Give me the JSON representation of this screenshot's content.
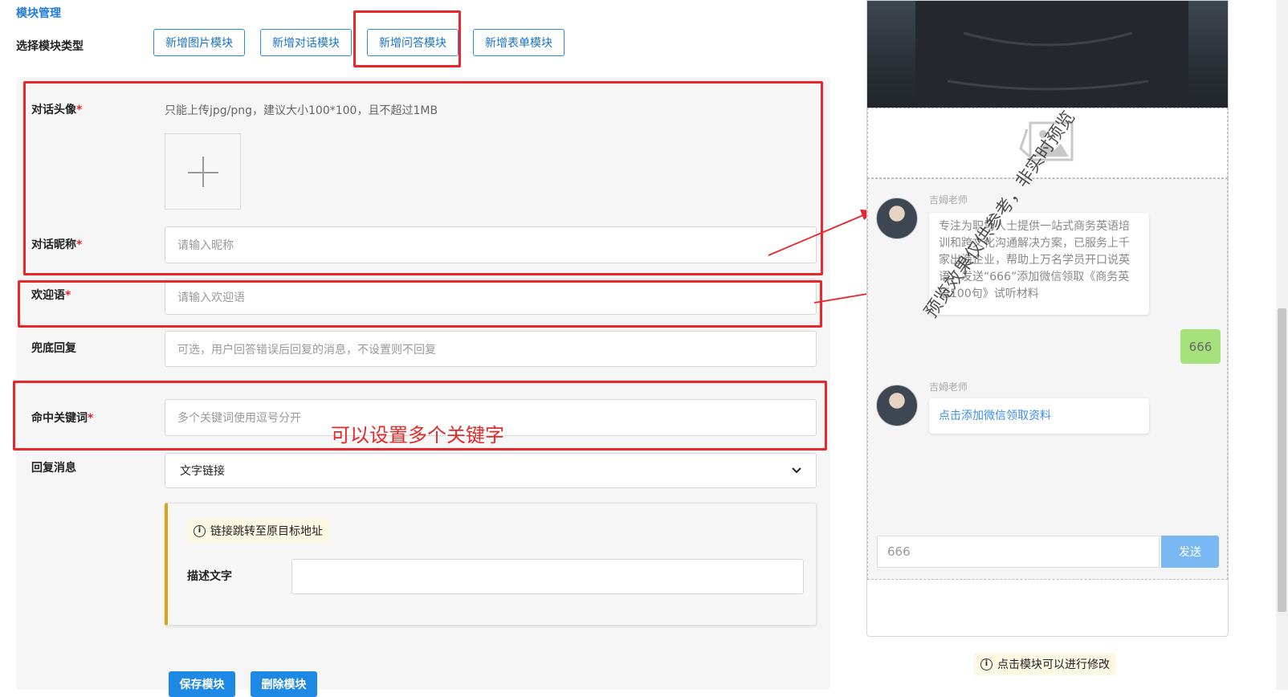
{
  "header": {
    "section_title": "模块管理",
    "type_label": "选择模块类型",
    "type_buttons": [
      "新增图片模块",
      "新增对话模块",
      "新增问答模块",
      "新增表单模块"
    ]
  },
  "form": {
    "avatar_label": "对话头像",
    "avatar_hint": "只能上传jpg/png，建议大小100*100，且不超过1MB",
    "nickname_label": "对话昵称",
    "nickname_placeholder": "请输入昵称",
    "welcome_label": "欢迎语",
    "welcome_placeholder": "请输入欢迎语",
    "fallback_label": "兜底回复",
    "fallback_placeholder": "可选，用户回答错误后回复的消息，不设置则不回复",
    "keyword_label": "命中关键词",
    "keyword_placeholder": "多个关键词使用逗号分开",
    "reply_label": "回复消息",
    "reply_selected": "文字链接",
    "link_notice": "链接跳转至原目标地址",
    "desc_label": "描述文字",
    "desc_value": "",
    "required_mark": "*",
    "save_button": "保存模块",
    "delete_button": "删除模块"
  },
  "annotation": {
    "keyword_note": "可以设置多个关键字"
  },
  "preview": {
    "sender_name": "吉姆老师",
    "welcome_message": "专注为职场人士提供一站式商务英语培训和跨文化沟通解决方案，已服务上千家出海企业，帮助上万名学员开口说英语，发送“666”添加微信领取《商务英语100句》试听材料",
    "user_reply": "666",
    "reply_sender_name": "吉姆老师",
    "reply_link": "点击添加微信领取资料",
    "input_value": "666",
    "send_button": "发送",
    "watermark": "预览效果仅供参考，非实时预览",
    "bottom_tip": "点击模块可以进行修改"
  },
  "colors": {
    "accent_blue": "#1e88e5",
    "annotation_red": "#e8262c",
    "reply_green": "#a6e27c",
    "send_blue": "#79b8f3",
    "notice_yellow": "#fcf8e3"
  }
}
